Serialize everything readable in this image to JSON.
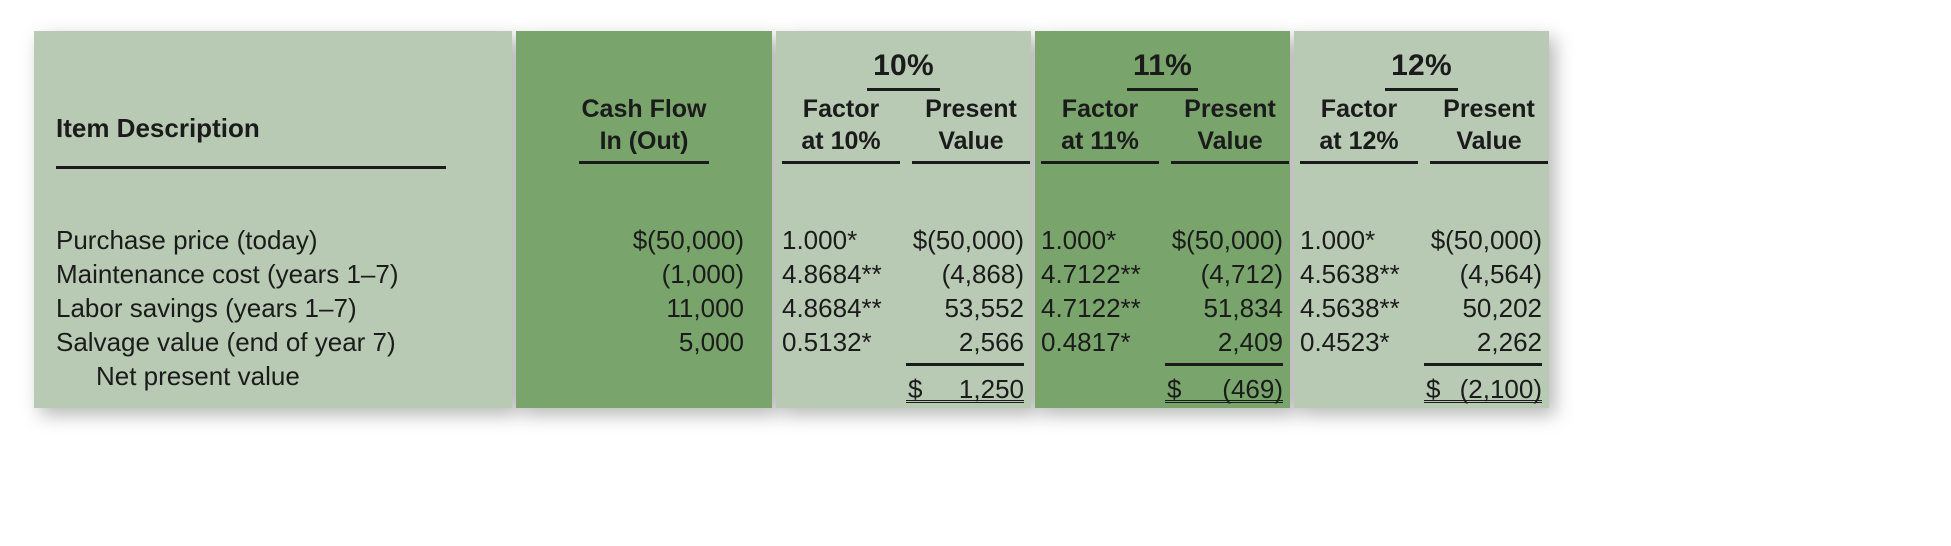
{
  "figure": {
    "name": "net-present-value-comparison-table",
    "colors": {
      "band_light": "#b9cab4",
      "band_dark": "#79a56c",
      "text": "#1b1b1b",
      "page_background": "#ffffff"
    }
  },
  "headers": {
    "item_description": "Item Description",
    "cash_flow_line1": "Cash Flow",
    "cash_flow_line2": "In (Out)",
    "factor_line1": "Factor",
    "present_line1": "Present",
    "present_line2": "Value"
  },
  "rate_columns": [
    {
      "rate_title": "10%",
      "factor_line2": "at 10%",
      "band_style": "light",
      "factors": [
        "1.000*",
        "4.8684**",
        "4.8684**",
        "0.5132*"
      ],
      "present_values": [
        "$(50,000)",
        "(4,868)",
        "53,552",
        "2,566"
      ],
      "total_currency": "$",
      "total_amount": "1,250"
    },
    {
      "rate_title": "11%",
      "factor_line2": "at 11%",
      "band_style": "dark",
      "factors": [
        "1.000*",
        "4.7122**",
        "4.7122**",
        "0.4817*"
      ],
      "present_values": [
        "$(50,000)",
        "(4,712)",
        "51,834",
        "2,409"
      ],
      "total_currency": "$",
      "total_amount": "(469)"
    },
    {
      "rate_title": "12%",
      "factor_line2": "at 12%",
      "band_style": "light",
      "factors": [
        "1.000*",
        "4.5638**",
        "4.5638**",
        "0.4523*"
      ],
      "present_values": [
        "$(50,000)",
        "(4,564)",
        "50,202",
        "2,262"
      ],
      "total_currency": "$",
      "total_amount": "(2,100)"
    }
  ],
  "rows": [
    {
      "description": "Purchase price (today)",
      "cash_flow": "$(50,000)",
      "indent": false
    },
    {
      "description": "Maintenance cost (years 1–7)",
      "cash_flow": "(1,000)",
      "indent": false
    },
    {
      "description": "Labor savings (years 1–7)",
      "cash_flow": "11,000",
      "indent": false
    },
    {
      "description": "Salvage value (end of year 7)",
      "cash_flow": "5,000",
      "indent": false
    }
  ],
  "total_row": {
    "description": "Net present value"
  }
}
